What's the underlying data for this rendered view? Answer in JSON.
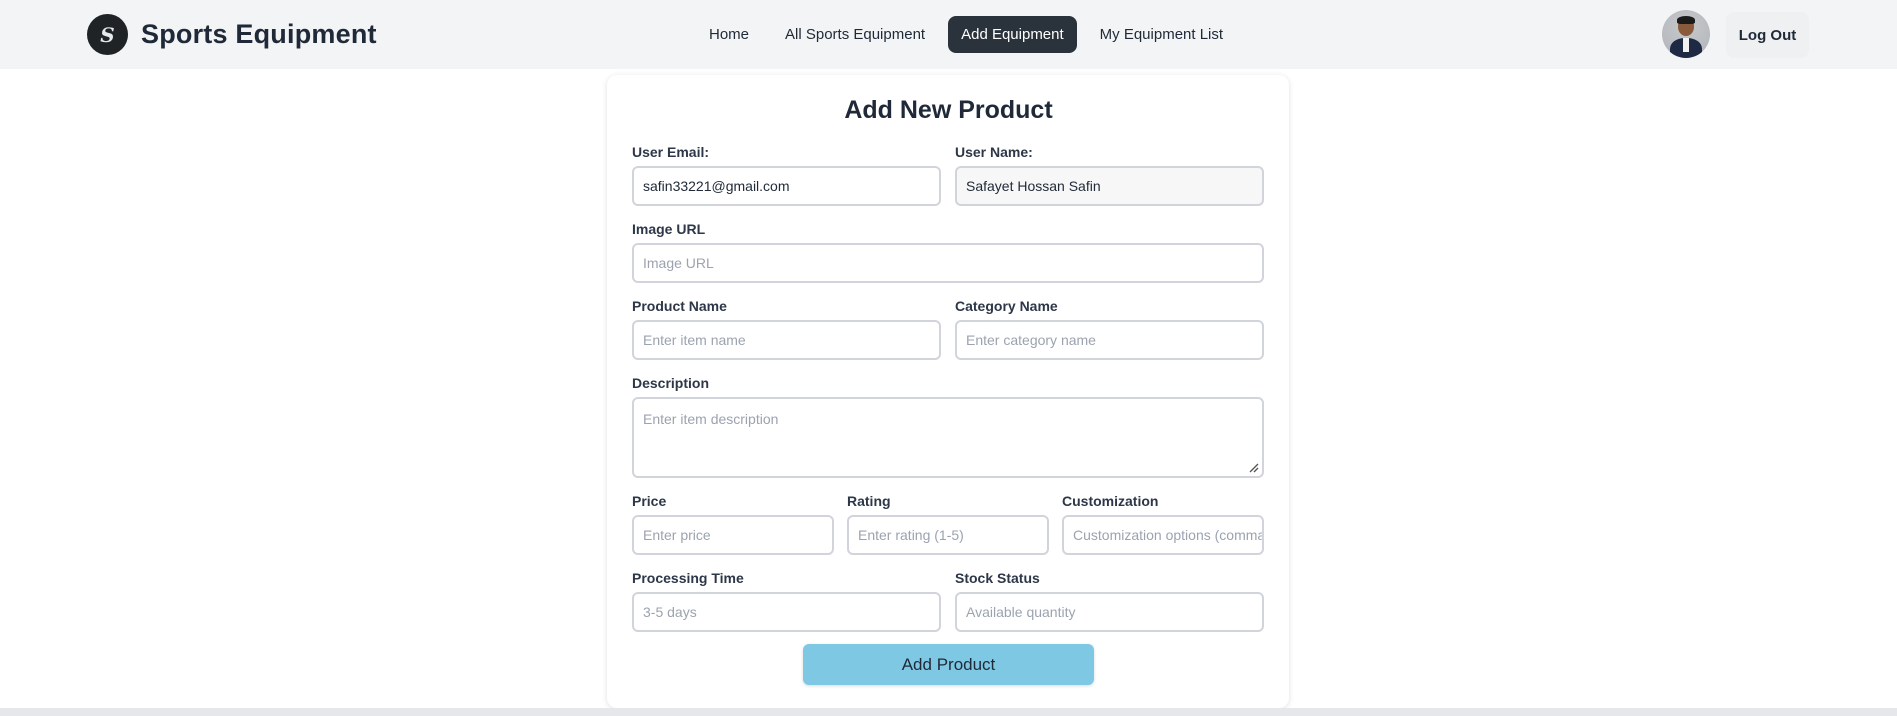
{
  "brand": {
    "title": "Sports Equipment",
    "logo_glyph": "S"
  },
  "nav": {
    "links": [
      {
        "label": "Home",
        "active": false
      },
      {
        "label": "All Sports Equipment",
        "active": false
      },
      {
        "label": "Add Equipment",
        "active": true
      },
      {
        "label": "My Equipment List",
        "active": false
      }
    ],
    "logout_label": "Log Out"
  },
  "form": {
    "title": "Add New Product",
    "user_email": {
      "label": "User Email:",
      "value": "safin33221@gmail.com"
    },
    "user_name": {
      "label": "User Name:",
      "value": "Safayet Hossan Safin"
    },
    "image_url": {
      "label": "Image URL",
      "placeholder": "Image URL"
    },
    "product_name": {
      "label": "Product Name",
      "placeholder": "Enter item name"
    },
    "category_name": {
      "label": "Category Name",
      "placeholder": "Enter category name"
    },
    "description": {
      "label": "Description",
      "placeholder": "Enter item description"
    },
    "price": {
      "label": "Price",
      "placeholder": "Enter price"
    },
    "rating": {
      "label": "Rating",
      "placeholder": "Enter rating (1-5)"
    },
    "customization": {
      "label": "Customization",
      "placeholder": "Customization options (comma separated)"
    },
    "processing_time": {
      "label": "Processing Time",
      "placeholder": "3-5 days"
    },
    "stock_status": {
      "label": "Stock Status",
      "placeholder": "Available quantity"
    },
    "submit_label": "Add Product"
  },
  "colors": {
    "navbar_bg": "#f3f4f6",
    "active_nav_bg": "#2a323c",
    "submit_bg": "#7ec8e3",
    "text_primary": "#1f2937"
  }
}
